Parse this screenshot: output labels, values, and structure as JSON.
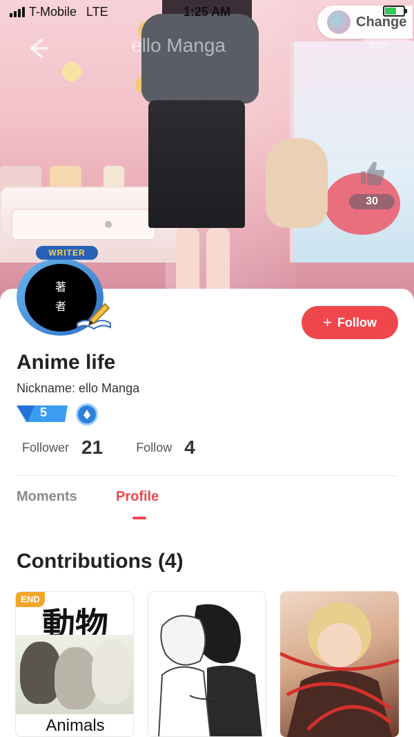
{
  "status_bar": {
    "carrier": "T-Mobile",
    "network": "LTE",
    "time": "1:25 AM"
  },
  "header": {
    "title": "ello Manga",
    "count": "386",
    "change_label": "Change",
    "likes": "30"
  },
  "profile": {
    "writer_tag": "WRITER",
    "avatar_text": [
      "著",
      "者"
    ],
    "follow_label": "Follow",
    "name": "Anime life",
    "nickname": "Nickname: ello Manga",
    "level": "5",
    "follower_label": "Follower",
    "follower_count": "21",
    "follow_label_stat": "Follow",
    "follow_count": "4"
  },
  "tabs": [
    {
      "label": "Moments",
      "active": false
    },
    {
      "label": "Profile",
      "active": true
    }
  ],
  "contributions": {
    "title": "Contributions (4)",
    "items": [
      {
        "badge": "END",
        "cover_text": "動物",
        "title": "Animals"
      },
      {
        "badge": "",
        "cover_text": "",
        "title": ""
      },
      {
        "badge": "",
        "cover_text": "",
        "title": ""
      }
    ]
  },
  "colors": {
    "accent": "#f0474d",
    "badge_orange": "#f4a62a",
    "level_blue": "#2d7fdc"
  }
}
